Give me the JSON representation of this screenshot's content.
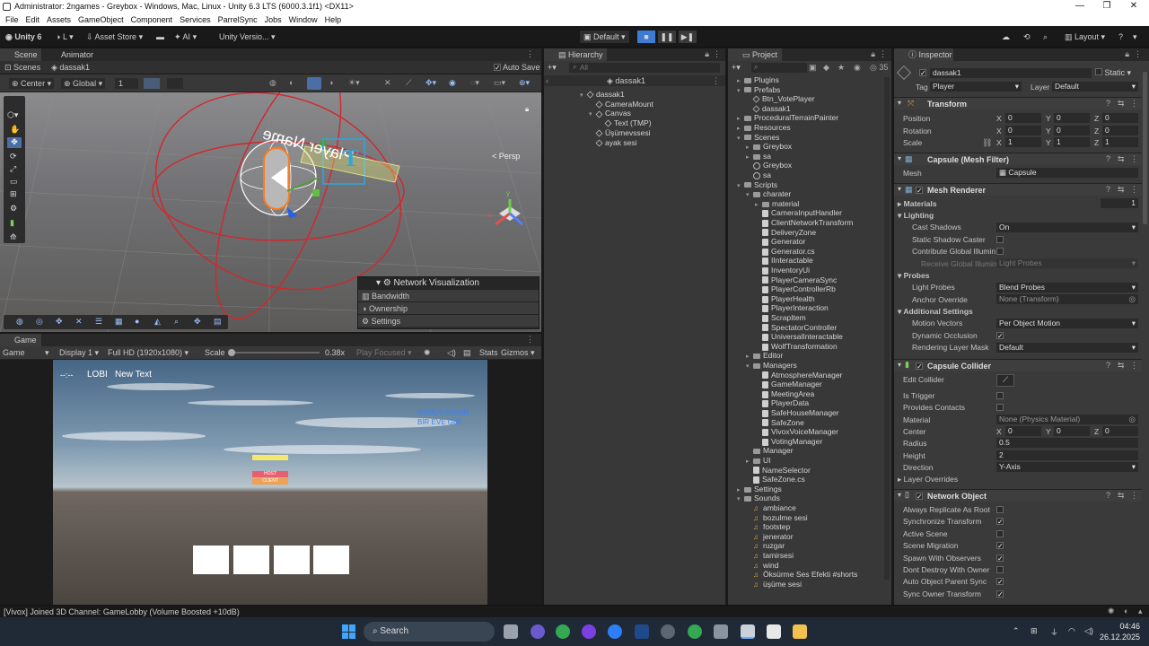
{
  "window": {
    "title": "Administrator: 2ngames - Greybox - Windows, Mac, Linux - Unity 6.3 LTS (6000.3.1f1) <DX11>",
    "minimize": "—",
    "maximize": "❐",
    "close": "✕"
  },
  "menu": [
    "File",
    "Edit",
    "Assets",
    "GameObject",
    "Component",
    "Services",
    "ParrelSync",
    "Jobs",
    "Window",
    "Help"
  ],
  "toolbar": {
    "unity": "Unity 6",
    "account": "L",
    "asset_store": "Asset Store",
    "ai": "AI",
    "version": "Unity Versio...",
    "play_mode": "Default",
    "layout": "Layout"
  },
  "scene": {
    "tabs": [
      "Scene",
      "Animator"
    ],
    "breadcrumb_root": "Scenes",
    "breadcrumb_item": "dassak1",
    "auto_save": "Auto Save",
    "pivot": "Center",
    "space": "Global",
    "snap": "1",
    "persp": "< Persp",
    "gizmo_text": "Player Name",
    "axis_y": "y",
    "axis_x": "x",
    "netvis_title": "Network Visualization",
    "netvis_items": [
      "Bandwidth",
      "Ownership",
      "Settings"
    ]
  },
  "game": {
    "tab": "Game",
    "mode": "Game",
    "display": "Display 1",
    "resolution": "Full HD (1920x1080)",
    "scale_label": "Scale",
    "scale_value": "0.38x",
    "play_focused": "Play Focused",
    "stats": "Stats",
    "gizmos": "Gizmos",
    "hud_time": "--:--",
    "hud_lobi": "LOBI",
    "hud_newtext": "New Text",
    "hud_right1": "OYNUYORSUN",
    "hud_right2": "BİR EVE GİR!",
    "host": "HOST",
    "client": "CLIENT",
    "colors": {
      "sky_top": "#4a6a8c",
      "ground": "#4a423c"
    }
  },
  "hierarchy": {
    "title": "Hierarchy",
    "search_placeholder": "All",
    "root": "dassak1",
    "items": [
      {
        "label": "dassak1",
        "depth": 1
      },
      {
        "label": "CameraMount",
        "depth": 2
      },
      {
        "label": "Canvas",
        "depth": 2
      },
      {
        "label": "Text (TMP)",
        "depth": 3
      },
      {
        "label": "Üşümevssesi",
        "depth": 2
      },
      {
        "label": "ayak sesi",
        "depth": 2
      }
    ]
  },
  "project": {
    "title": "Project",
    "count": "35",
    "items": [
      {
        "label": "Plugins",
        "depth": 0,
        "type": "folder"
      },
      {
        "label": "Prefabs",
        "depth": 0,
        "type": "folder",
        "open": true
      },
      {
        "label": "Btn_VotePlayer",
        "depth": 1,
        "type": "cube"
      },
      {
        "label": "dassak1",
        "depth": 1,
        "type": "cube"
      },
      {
        "label": "ProceduralTerrainPainter",
        "depth": 0,
        "type": "folder"
      },
      {
        "label": "Resources",
        "depth": 0,
        "type": "folder"
      },
      {
        "label": "Scenes",
        "depth": 0,
        "type": "folder",
        "open": true
      },
      {
        "label": "Greybox",
        "depth": 1,
        "type": "folder"
      },
      {
        "label": "sa",
        "depth": 1,
        "type": "folder"
      },
      {
        "label": "Greybox",
        "depth": 1,
        "type": "scene"
      },
      {
        "label": "sa",
        "depth": 1,
        "type": "scene"
      },
      {
        "label": "Scripts",
        "depth": 0,
        "type": "folder",
        "open": true
      },
      {
        "label": "charater",
        "depth": 1,
        "type": "folder",
        "open": true
      },
      {
        "label": "material",
        "depth": 2,
        "type": "folder"
      },
      {
        "label": "CameraInputHandler",
        "depth": 2,
        "type": "cs"
      },
      {
        "label": "ClientNetworkTransform",
        "depth": 2,
        "type": "cs"
      },
      {
        "label": "DeliveryZone",
        "depth": 2,
        "type": "cs"
      },
      {
        "label": "Generator",
        "depth": 2,
        "type": "cs"
      },
      {
        "label": "Generator.cs",
        "depth": 2,
        "type": "cs"
      },
      {
        "label": "IInteractable",
        "depth": 2,
        "type": "cs"
      },
      {
        "label": "InventoryUi",
        "depth": 2,
        "type": "cs"
      },
      {
        "label": "PlayerCameraSync",
        "depth": 2,
        "type": "cs"
      },
      {
        "label": "PlayerControllerRb",
        "depth": 2,
        "type": "cs"
      },
      {
        "label": "PlayerHealth",
        "depth": 2,
        "type": "cs"
      },
      {
        "label": "PlayerInteraction",
        "depth": 2,
        "type": "cs"
      },
      {
        "label": "ScrapItem",
        "depth": 2,
        "type": "cs"
      },
      {
        "label": "SpectatorController",
        "depth": 2,
        "type": "cs"
      },
      {
        "label": "UniversalInteractable",
        "depth": 2,
        "type": "cs"
      },
      {
        "label": "WolfTransformation",
        "depth": 2,
        "type": "cs"
      },
      {
        "label": "Editor",
        "depth": 1,
        "type": "folder"
      },
      {
        "label": "Managers",
        "depth": 1,
        "type": "folder",
        "open": true
      },
      {
        "label": "AtmosphereManager",
        "depth": 2,
        "type": "cs"
      },
      {
        "label": "GameManager",
        "depth": 2,
        "type": "cs"
      },
      {
        "label": "MeetingArea",
        "depth": 2,
        "type": "cs"
      },
      {
        "label": "PlayerData",
        "depth": 2,
        "type": "cs"
      },
      {
        "label": "SafeHouseManager",
        "depth": 2,
        "type": "cs"
      },
      {
        "label": "SafeZone",
        "depth": 2,
        "type": "cs"
      },
      {
        "label": "VivoxVoiceManager",
        "depth": 2,
        "type": "cs"
      },
      {
        "label": "VotingManager",
        "depth": 2,
        "type": "cs"
      },
      {
        "label": "Manager",
        "depth": 1,
        "type": "folder0"
      },
      {
        "label": "UI",
        "depth": 1,
        "type": "folder"
      },
      {
        "label": "NameSelector",
        "depth": 1,
        "type": "cs"
      },
      {
        "label": "SafeZone.cs",
        "depth": 1,
        "type": "cs"
      },
      {
        "label": "Settings",
        "depth": 0,
        "type": "folder"
      },
      {
        "label": "Sounds",
        "depth": 0,
        "type": "folder",
        "open": true
      },
      {
        "label": "ambiance",
        "depth": 1,
        "type": "audio"
      },
      {
        "label": "bozulme sesi",
        "depth": 1,
        "type": "audio"
      },
      {
        "label": "footstep",
        "depth": 1,
        "type": "audio"
      },
      {
        "label": "jenerator",
        "depth": 1,
        "type": "audio"
      },
      {
        "label": "ruzgar",
        "depth": 1,
        "type": "audio"
      },
      {
        "label": "tamirsesi",
        "depth": 1,
        "type": "audio"
      },
      {
        "label": "wind",
        "depth": 1,
        "type": "audio"
      },
      {
        "label": "Öksürme  Ses Efekti #shorts",
        "depth": 1,
        "type": "audio"
      },
      {
        "label": "üşüme sesi",
        "depth": 1,
        "type": "audio"
      }
    ]
  },
  "inspector": {
    "title": "Inspector",
    "name": "dassak1",
    "static": "Static",
    "tag_label": "Tag",
    "tag": "Player",
    "layer_label": "Layer",
    "layer": "Default",
    "transform": {
      "title": "Transform",
      "rows": [
        {
          "label": "Position",
          "x": "0",
          "y": "0",
          "z": "0"
        },
        {
          "label": "Rotation",
          "x": "0",
          "y": "0",
          "z": "0"
        },
        {
          "label": "Scale",
          "x": "1",
          "y": "1",
          "z": "1"
        }
      ]
    },
    "mesh_filter": {
      "title": "Capsule (Mesh Filter)",
      "mesh_label": "Mesh",
      "mesh": "Capsule"
    },
    "mesh_renderer": {
      "title": "Mesh Renderer",
      "materials": "Materials",
      "materials_count": "1",
      "lighting": "Lighting",
      "cast_shadows": "Cast Shadows",
      "cast_shadows_val": "On",
      "static_shadow": "Static Shadow Caster",
      "contribute": "Contribute Global Illumin",
      "receive": "Receive Global Illumin",
      "receive_val": "Light Probes",
      "probes": "Probes",
      "light_probes": "Light Probes",
      "light_probes_val": "Blend Probes",
      "anchor": "Anchor Override",
      "anchor_val": "None (Transform)",
      "additional": "Additional Settings",
      "motion": "Motion Vectors",
      "motion_val": "Per Object Motion",
      "dynamic": "Dynamic Occlusion",
      "rendering_mask": "Rendering Layer Mask",
      "rendering_mask_val": "Default"
    },
    "collider": {
      "title": "Capsule Collider",
      "edit": "Edit Collider",
      "trigger": "Is Trigger",
      "contacts": "Provides Contacts",
      "material": "Material",
      "material_val": "None (Physics Material)",
      "center": "Center",
      "cx": "0",
      "cy": "0",
      "cz": "0",
      "radius": "Radius",
      "radius_val": "0.5",
      "height": "Height",
      "height_val": "2",
      "direction": "Direction",
      "direction_val": "Y-Axis",
      "layer_overrides": "Layer Overrides"
    },
    "network": {
      "title": "Network Object",
      "rows": [
        {
          "label": "Always Replicate As Root",
          "checked": false
        },
        {
          "label": "Synchronize Transform",
          "checked": true
        },
        {
          "label": "Active Scene Synchronizati",
          "checked": false
        },
        {
          "label": "Scene Migration Synchroni",
          "checked": true
        },
        {
          "label": "Spawn With Observers",
          "checked": true
        },
        {
          "label": "Dont Destroy With Owner",
          "checked": false
        },
        {
          "label": "Auto Object Parent Sync",
          "checked": true
        },
        {
          "label": "Sync Owner Transform Whe",
          "checked": true
        }
      ]
    }
  },
  "status": {
    "message": "[Vivox] Joined 3D Channel: GameLobby (Volume Boosted +10dB)"
  },
  "taskbar": {
    "search": "Search",
    "time": "04:46",
    "date": "26.12.2025"
  }
}
